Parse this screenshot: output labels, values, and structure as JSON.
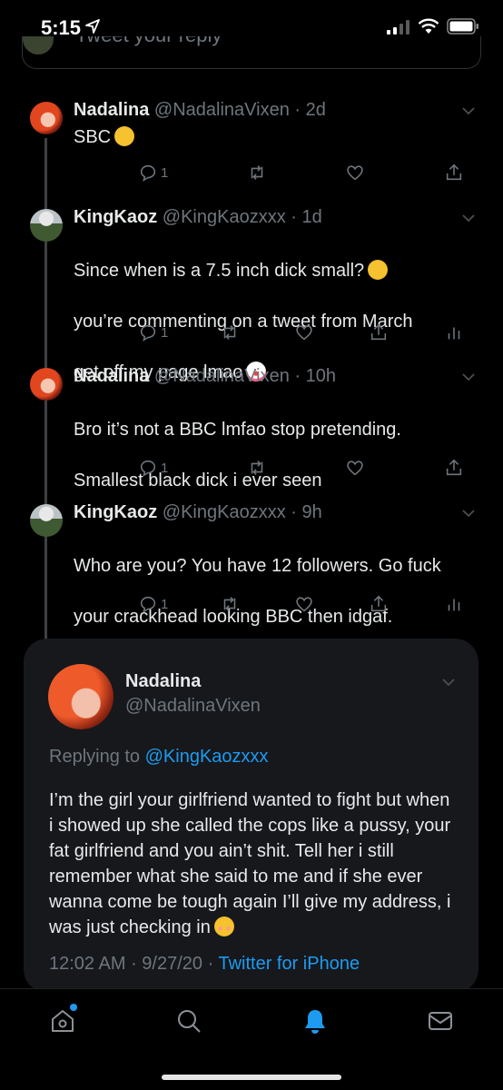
{
  "status_bar": {
    "time": "5:15"
  },
  "compose": {
    "placeholder": "Tweet your reply"
  },
  "tweets": [
    {
      "name": "Nadalina",
      "handle": "@NadalinaVixen",
      "age": "2d",
      "text": "SBC",
      "emoji": "rolling-on-floor-laughing",
      "reply_count": "1"
    },
    {
      "name": "KingKaoz",
      "handle": "@KingKaozxxx",
      "age": "1d",
      "text": "Since when is a 7.5 inch dick small? [joy] you’re commenting on a tweet from March get off my page lmao [clown]",
      "line1": "Since when is a 7.5 inch dick small?",
      "line2": "you’re commenting on a tweet from March",
      "line3": "get off my page lmao",
      "reply_count": "1"
    },
    {
      "name": "Nadalina",
      "handle": "@NadalinaVixen",
      "age": "10h",
      "line1": "Bro it’s not a BBC lmfao stop pretending.",
      "line2": "Smallest black dick i ever seen",
      "reply_count": "1"
    },
    {
      "name": "KingKaoz",
      "handle": "@KingKaozxxx",
      "age": "9h",
      "line1": "Who are you? You have 12 followers. Go fuck",
      "line2": "your crackhead looking BBC then idgaf.",
      "reply_count": "1"
    }
  ],
  "focused": {
    "name": "Nadalina",
    "handle": "@NadalinaVixen",
    "replying_label": "Replying to",
    "replying_to": "@KingKaozxxx",
    "text": "I’m the girl your girlfriend wanted to fight but when i showed up she called the cops like a pussy, your fat girlfriend and you ain’t shit. Tell her i still remember what she said to me and if she ever wanna come be tough again I’ll give my address, i was just checking in",
    "time": "12:02 AM",
    "date": "9/27/20",
    "source": "Twitter for iPhone"
  },
  "colors": {
    "accent": "#1d9bf0",
    "muted": "#6e767d",
    "card": "#16181c"
  },
  "tabs": [
    "home-icon",
    "search-icon",
    "notifications-icon",
    "messages-icon"
  ]
}
